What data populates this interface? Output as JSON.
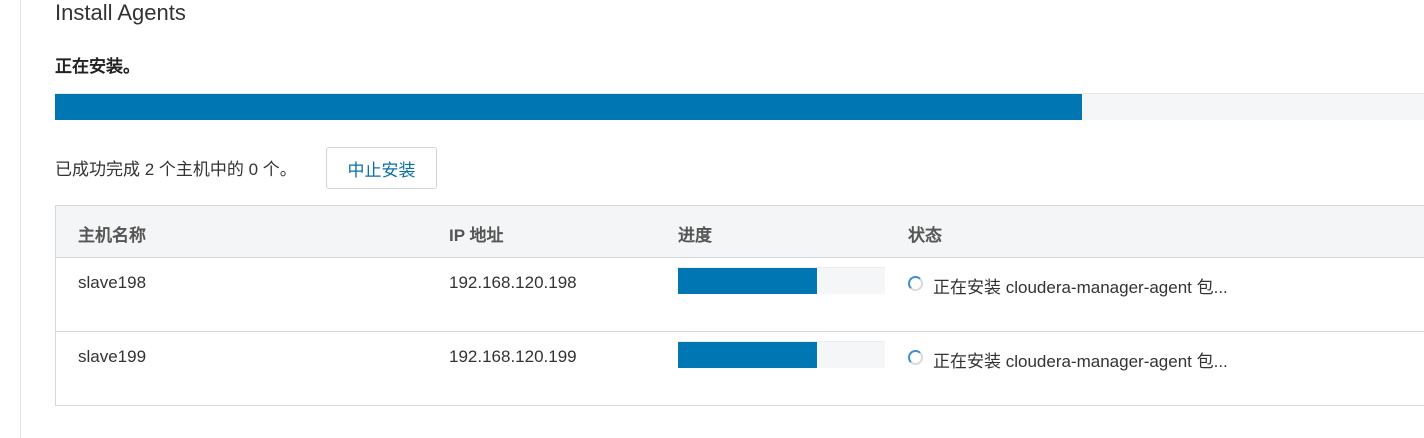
{
  "page": {
    "title": "Install Agents",
    "status_heading": "正在安装。",
    "overall_progress": 0.75
  },
  "summary": {
    "text": "已成功完成 2 个主机中的 0 个。",
    "abort_label": "中止安装"
  },
  "table": {
    "columns": [
      "主机名称",
      "IP 地址",
      "进度",
      "状态"
    ],
    "rows": [
      {
        "host": "slave198",
        "ip": "192.168.120.198",
        "progress": 0.67,
        "status": "正在安装 cloudera-manager-agent 包..."
      },
      {
        "host": "slave199",
        "ip": "192.168.120.199",
        "progress": 0.67,
        "status": "正在安装 cloudera-manager-agent 包..."
      }
    ]
  },
  "colors": {
    "progress_fill": "#0077b3",
    "link_text": "#0a6fa8"
  },
  "icons": {
    "row_status": "loading-spinner-icon"
  }
}
